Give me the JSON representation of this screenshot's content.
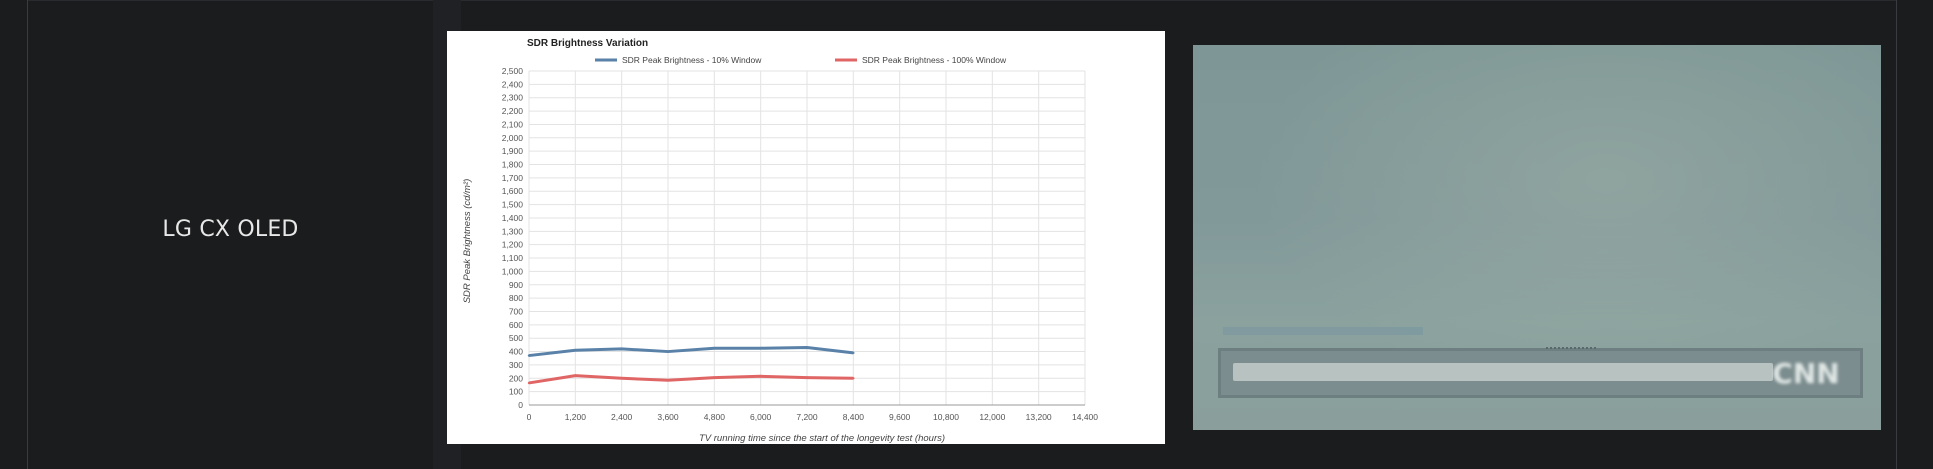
{
  "row": {
    "name": "LG CX OLED"
  },
  "photo": {
    "logo_text": "CNN"
  },
  "chart_data": {
    "type": "line",
    "title": "SDR Brightness Variation",
    "xlabel": "TV running time since the start of the longevity test (hours)",
    "ylabel": "SDR Peak Brightness (cd/m²)",
    "xlim": [
      0,
      14400
    ],
    "ylim": [
      0,
      2500
    ],
    "x_ticks": [
      0,
      1200,
      2400,
      3600,
      4800,
      6000,
      7200,
      8400,
      9600,
      10800,
      12000,
      13200,
      14400
    ],
    "x_tick_labels": [
      "0",
      "1,200",
      "2,400",
      "3,600",
      "4,800",
      "6,000",
      "7,200",
      "8,400",
      "9,600",
      "10,800",
      "12,000",
      "13,200",
      "14,400"
    ],
    "y_ticks": [
      0,
      100,
      200,
      300,
      400,
      500,
      600,
      700,
      800,
      900,
      1000,
      1100,
      1200,
      1300,
      1400,
      1500,
      1600,
      1700,
      1800,
      1900,
      2000,
      2100,
      2200,
      2300,
      2400,
      2500
    ],
    "y_tick_labels": [
      "0",
      "100",
      "200",
      "300",
      "400",
      "500",
      "600",
      "700",
      "800",
      "900",
      "1,000",
      "1,100",
      "1,200",
      "1,300",
      "1,400",
      "1,500",
      "1,600",
      "1,700",
      "1,800",
      "1,900",
      "2,000",
      "2,100",
      "2,200",
      "2,300",
      "2,400",
      "2,500"
    ],
    "grid": true,
    "legend_position": "top",
    "series": [
      {
        "name": "SDR Peak Brightness - 10% Window",
        "color": "#5a82a8",
        "x": [
          0,
          1200,
          2400,
          3600,
          4800,
          6000,
          7200,
          8400
        ],
        "y": [
          370,
          410,
          420,
          400,
          425,
          425,
          430,
          390
        ]
      },
      {
        "name": "SDR Peak Brightness - 100% Window",
        "color": "#e06666",
        "x": [
          0,
          1200,
          2400,
          3600,
          4800,
          6000,
          7200,
          8400
        ],
        "y": [
          165,
          220,
          200,
          185,
          205,
          215,
          205,
          200
        ]
      }
    ]
  }
}
